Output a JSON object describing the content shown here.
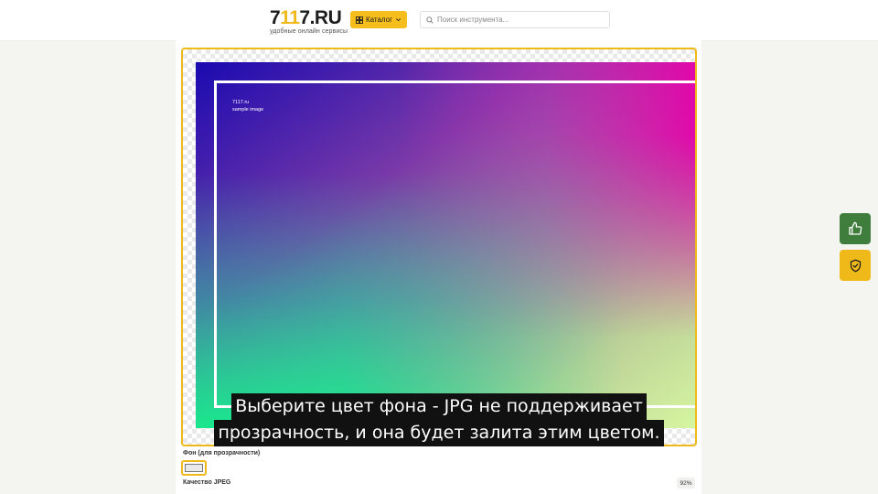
{
  "header": {
    "logo": {
      "part1": "7",
      "part2": "11",
      "part3": "7.RU",
      "tagline": "удобные онлайн сервисы"
    },
    "catalog_label": "Каталог",
    "search_placeholder": "Поиск инструмента..."
  },
  "preview": {
    "caption_line1": "7117.ru",
    "caption_line2": "sample image"
  },
  "settings": {
    "background_label": "Фон (для прозрачности)",
    "background_color": "#e9e9e9",
    "quality_label": "Качество JPEG",
    "quality_value": "92%"
  },
  "subtitles": {
    "line1": "Выберите цвет фона - JPG не поддерживает",
    "line2": "прозрачность, и она будет залита этим цветом."
  },
  "side_buttons": {
    "like_icon": "thumbs-up-icon",
    "shield_icon": "shield-check-icon"
  },
  "colors": {
    "accent": "#f0b91a",
    "like_bg": "#3f7d3c"
  }
}
